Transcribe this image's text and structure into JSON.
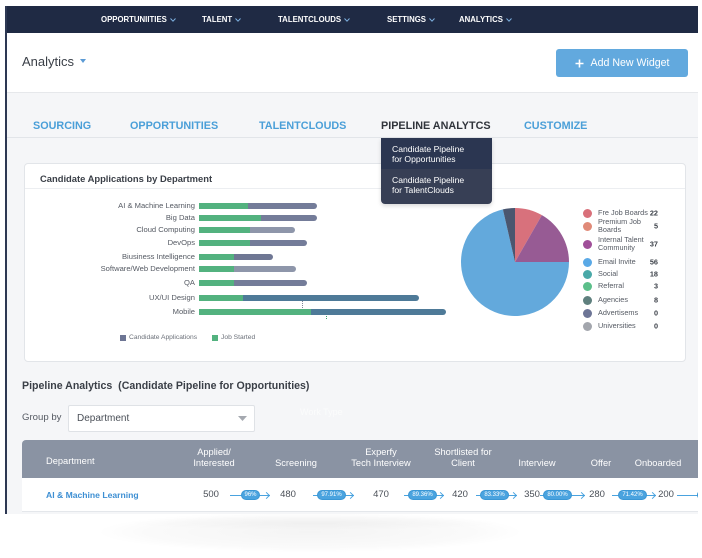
{
  "nav": {
    "items": [
      {
        "label": "OPPORTUNIITIES"
      },
      {
        "label": "TALENT"
      },
      {
        "label": "TALENTCLOUDS"
      },
      {
        "label": "SETTINGS"
      },
      {
        "label": "ANALYTICS"
      }
    ]
  },
  "header": {
    "title": "Analytics",
    "add_widget_label": "Add New Widget"
  },
  "tabs": [
    {
      "label": "SOURCING",
      "active": false
    },
    {
      "label": "OPPORTUNITIES",
      "active": false
    },
    {
      "label": "TALENTCLOUDS",
      "active": false
    },
    {
      "label": "PIPELINE ANALYTCS",
      "active": true
    },
    {
      "label": "CUSTOMIZE",
      "active": false
    }
  ],
  "pipeline_menu": {
    "items": [
      {
        "label": "Candidate Pipeline\nfor Opportunities"
      },
      {
        "label": "Candidate Pipeline\nfor TalentClouds"
      }
    ]
  },
  "department_card": {
    "title": "Candidate Applications by Department"
  },
  "chart_data": [
    {
      "type": "bar",
      "orientation": "horizontal",
      "title": "Candidate Applications by Department",
      "xlabel": "",
      "ylabel": "",
      "categories": [
        "AI & Machine Learning",
        "Big Data",
        "Cloud Computing",
        "DevOps",
        "Biusiness Intelligence",
        "Software/Web Development",
        "QA",
        "UX/UI Design",
        "Mobile"
      ],
      "series": [
        {
          "name": "Candidate Applications",
          "values": [
            118,
            118,
            96,
            108,
            74,
            97,
            108,
            220,
            247
          ],
          "colors": [
            "#747c99",
            "#747c99",
            "#8e96aa",
            "#747c99",
            "#6f7794",
            "#8e96aa",
            "#747c99",
            "#4e7a98",
            "#4e7a98"
          ]
        },
        {
          "name": "Job Started",
          "values": [
            49,
            62,
            51,
            51,
            35,
            35,
            35,
            44,
            112
          ],
          "color": "#53b27f"
        }
      ],
      "xlim": [
        0,
        250
      ],
      "grid": false,
      "legend": {
        "position": "bottom-left",
        "entries": [
          {
            "label": "Candidate Applications",
            "color": "#6d7594"
          },
          {
            "label": "Job Started",
            "color": "#53b27f"
          }
        ]
      }
    },
    {
      "type": "pie",
      "title": "",
      "start": "12 o'clock",
      "direction": "clockwise",
      "slices": [
        {
          "label": "Fre Job Boards",
          "share_pct": 8.3,
          "color": "#d8717c"
        },
        {
          "label": "Internal Talent Community",
          "share_pct": 16.7,
          "color": "#975b94"
        },
        {
          "label": "Email Invite",
          "share_pct": 71.4,
          "color": "#63a9dc"
        },
        {
          "label": "Advertisems",
          "share_pct": 3.6,
          "color": "#4a566f"
        }
      ],
      "legend": {
        "position": "right",
        "entries": [
          {
            "label": "Fre Job Boards",
            "value": 22,
            "color": "#d9707a"
          },
          {
            "label": "Premium Job\nBoards",
            "value": 5,
            "color": "#e08a78"
          },
          {
            "label": "Internal Talent\nCommunity",
            "value": 37,
            "color": "#a04f99"
          },
          {
            "label": "Email Invite",
            "value": 56,
            "color": "#5aa9e6"
          },
          {
            "label": "Social",
            "value": 18,
            "color": "#4aa9a8"
          },
          {
            "label": "Referral",
            "value": 3,
            "color": "#5cbf8a"
          },
          {
            "label": "Agencies",
            "value": 8,
            "color": "#5f807e"
          },
          {
            "label": "Advertisems",
            "value": 0,
            "color": "#6d7596"
          },
          {
            "label": "Universities",
            "value": 0,
            "color": "#a3a6ad"
          }
        ]
      }
    }
  ],
  "pipeline": {
    "title": "Pipeline Analytics  (Candidate Pipeline for Opportunities)",
    "group_by": {
      "label": "Group by",
      "value": "Department"
    },
    "faint_label": "Work Type",
    "columns": [
      "Department",
      "Applied/\nInterested",
      "Screening",
      "Experfy\nTech Interview",
      "Shortlisted for\nClient",
      "Interview",
      "Offer",
      "Onboarded"
    ],
    "rows": [
      {
        "department": "AI & Machine Learning",
        "values": [
          "500",
          "480",
          "470",
          "420",
          "350",
          "280",
          "200"
        ],
        "rates": [
          "96%",
          "97.91%",
          "89.36%",
          "83.33%",
          "80.00%",
          "71.42%"
        ]
      }
    ]
  },
  "colors": {
    "nav_bg": "#1f2a44",
    "accent": "#62a9de",
    "tab_link": "#4a9fd8",
    "link": "#3d8fd3",
    "table_header": "#8a93a3",
    "rate_pill": "#4aa3df"
  }
}
